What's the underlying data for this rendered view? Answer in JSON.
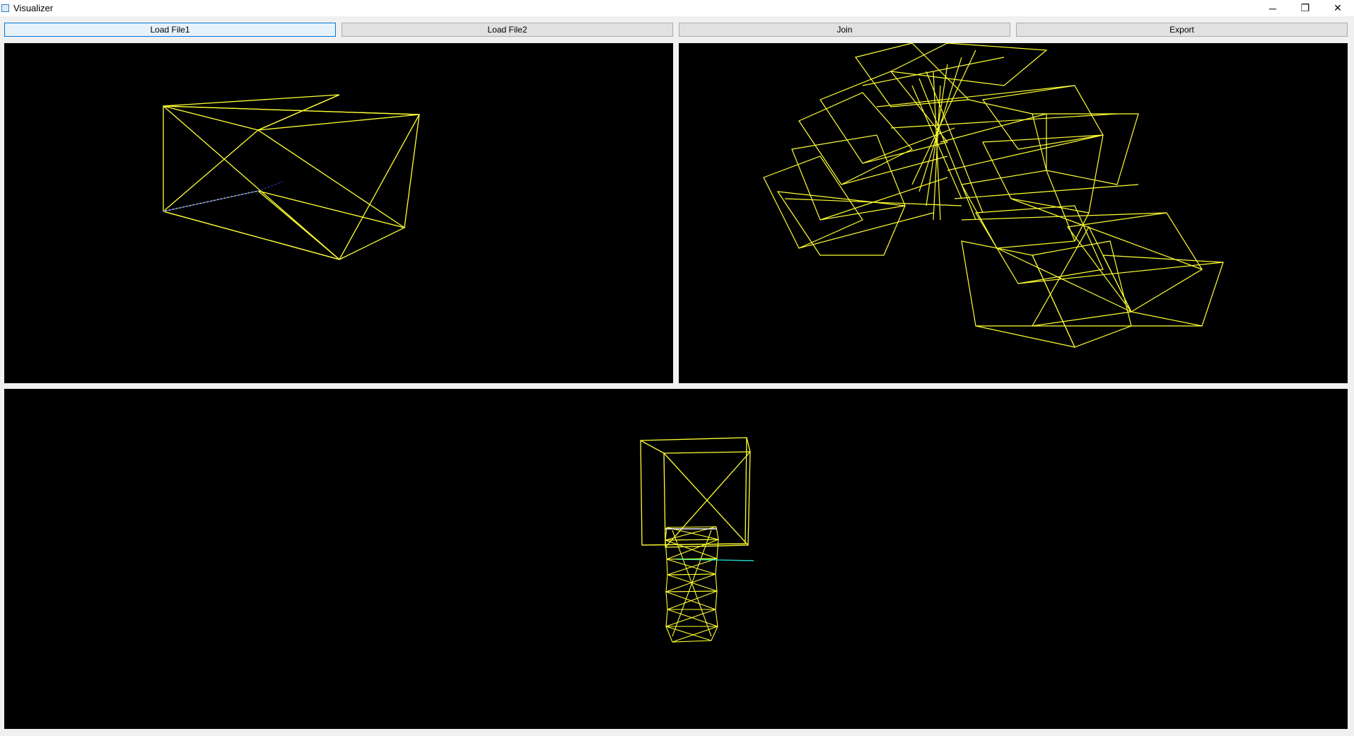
{
  "window": {
    "title": "Visualizer",
    "controls": {
      "minimize": "─",
      "restore": "❐",
      "close": "✕"
    }
  },
  "toolbar": {
    "load_file1": "Load File1",
    "load_file2": "Load File2",
    "join": "Join",
    "export": "Export"
  },
  "viewports": {
    "view1": {
      "name": "file1-view",
      "wire_color": "#ffff33"
    },
    "view2": {
      "name": "file2-view",
      "wire_color": "#ffff33"
    },
    "view3": {
      "name": "joined-view",
      "wire_color": "#ffff33"
    }
  },
  "colors": {
    "background": "#000000",
    "wireframe": "#ffff33",
    "axis_blue": "#3a4cff",
    "axis_cyan": "#22d3c5",
    "focus_border": "#0078d7"
  }
}
